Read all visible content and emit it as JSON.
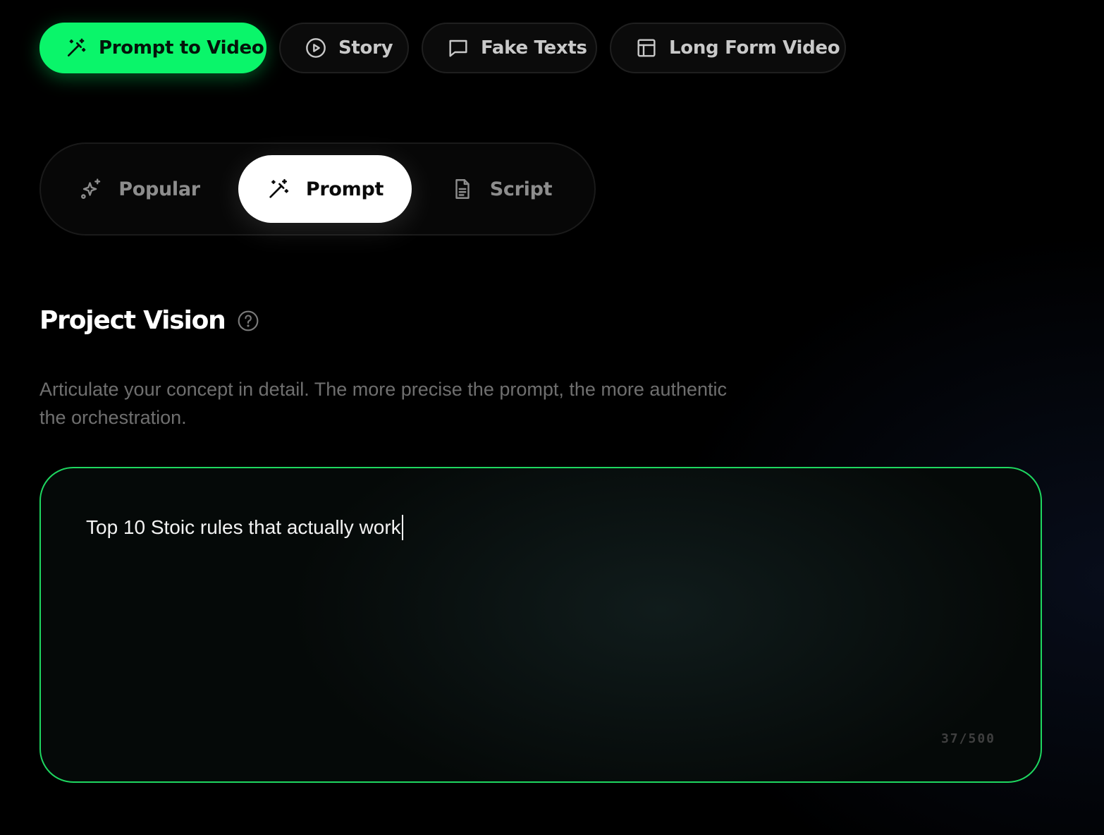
{
  "mode_tabs": [
    {
      "label": "Prompt to Video",
      "icon": "magic-wand-icon",
      "active": true
    },
    {
      "label": "Story",
      "icon": "play-circle-icon",
      "active": false
    },
    {
      "label": "Fake Texts",
      "icon": "chat-bubble-icon",
      "active": false
    },
    {
      "label": "Long Form Video",
      "icon": "layout-icon",
      "active": false
    }
  ],
  "sub_tabs": [
    {
      "label": "Popular",
      "icon": "sparkles-icon",
      "active": false
    },
    {
      "label": "Prompt",
      "icon": "magic-wand-icon",
      "active": true
    },
    {
      "label": "Script",
      "icon": "document-icon",
      "active": false
    }
  ],
  "section": {
    "title": "Project Vision",
    "help_icon": "question-circle-icon",
    "description": "Articulate your concept in detail. The more precise the prompt, the more authentic the orchestration."
  },
  "prompt": {
    "value": "Top 10 Stoic rules that actually work",
    "char_count": "37/500"
  },
  "colors": {
    "accent": "#0af56a",
    "input_border": "#1ed760",
    "background": "#000000"
  }
}
